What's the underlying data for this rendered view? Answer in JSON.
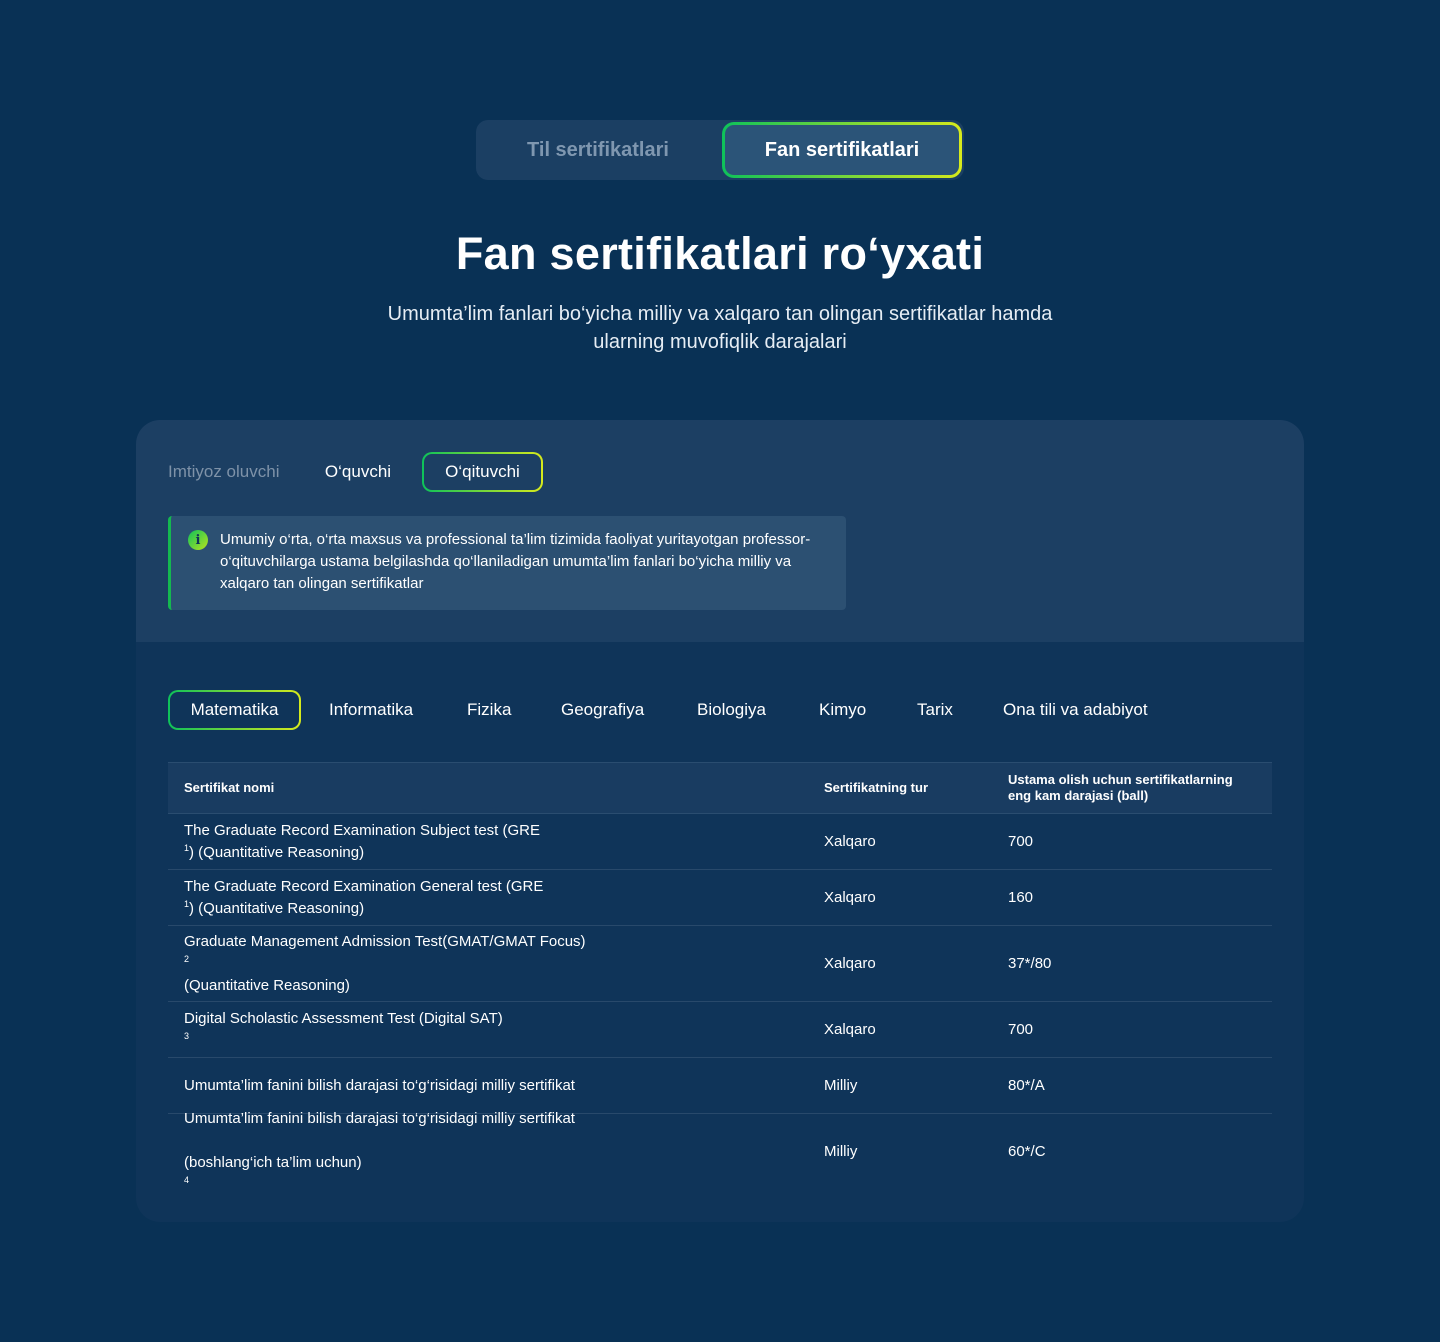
{
  "top_tabs": [
    {
      "label": "Til sertifikatlari",
      "active": false
    },
    {
      "label": "Fan sertifikatlari",
      "active": true
    }
  ],
  "page": {
    "title": "Fan sertifikatlari ro‘yxati",
    "subtitle": "Umumta’lim fanlari bo‘yicha milliy va xalqaro tan olingan sertifikatlar hamda ularning muvofiqlik darajalari"
  },
  "role_tabs": [
    {
      "label": "Imtiyoz oluvchi",
      "active": false
    },
    {
      "label": "O‘quvchi",
      "active": false
    },
    {
      "label": "O‘qituvchi",
      "active": true
    }
  ],
  "info": {
    "icon": "info-icon",
    "text": "Umumiy o‘rta, o‘rta maxsus va professional ta’lim tizimida faoliyat yuritayotgan professor-o‘qituvchilarga ustama belgilashda qo‘llaniladigan umumta’lim fanlari bo‘yicha milliy va xalqaro tan olingan sertifikatlar"
  },
  "subject_tabs": [
    {
      "label": "Matematika",
      "active": true
    },
    {
      "label": "Informatika",
      "active": false
    },
    {
      "label": "Fizika",
      "active": false
    },
    {
      "label": "Geografiya",
      "active": false
    },
    {
      "label": "Biologiya",
      "active": false
    },
    {
      "label": "Kimyo",
      "active": false
    },
    {
      "label": "Tarix",
      "active": false
    },
    {
      "label": "Ona tili va adabiyot",
      "active": false
    }
  ],
  "table": {
    "headers": [
      "Sertifikat nomi",
      "Sertifikatning tur",
      "Ustama olish uchun sertifikatlarning eng kam darajasi (ball)"
    ],
    "rows": [
      {
        "name": "The Graduate Record Examination Subject test (GRE",
        "sup": "1",
        "name_tail": ") (Quantitative Reasoning)",
        "type": "Xalqaro",
        "score": "700"
      },
      {
        "name": "The Graduate Record Examination General test (GRE",
        "sup": "1",
        "name_tail": ") (Quantitative Reasoning)",
        "type": "Xalqaro",
        "score": "160"
      },
      {
        "name": "Graduate Management Admission Test(GMAT/GMAT Focus)",
        "sup": "2",
        "name_tail": "",
        "line2": "(Quantitative Reasoning)",
        "type": "Xalqaro",
        "score": "37*/80"
      },
      {
        "name": "Digital Scholastic Assessment Test (Digital SAT)",
        "sup": "3",
        "name_tail": "",
        "type": "Xalqaro",
        "score": "700"
      },
      {
        "name": "Umumta’lim fanini bilish darajasi to‘g‘risidagi milliy sertifikat",
        "sup": "",
        "name_tail": "",
        "type": "Milliy",
        "score": "80*/A"
      },
      {
        "name": "Umumta’lim fanini bilish darajasi to‘g‘risidagi milliy sertifikat",
        "sup": "",
        "name_tail": "",
        "line2": "(boshlang‘ich ta’lim uchun)",
        "line2_sup": "4",
        "type": "Milliy",
        "score": "60*/C"
      }
    ]
  },
  "colors": {
    "background": "#093155",
    "card": "#0f3459",
    "accent_start": "#0ec25a",
    "accent_end": "#d7ea1c"
  }
}
